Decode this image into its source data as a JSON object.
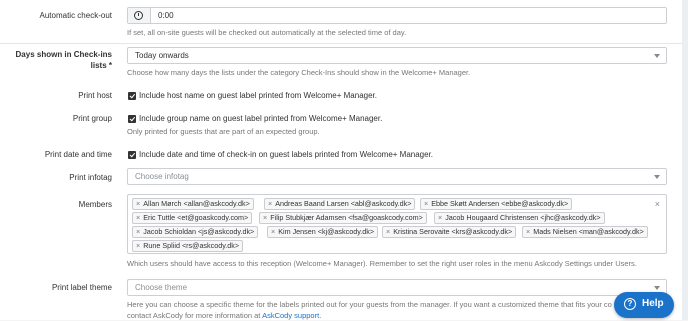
{
  "auto_checkout": {
    "label": "Automatic check-out",
    "value": "0:00",
    "help": "If set, all on-site guests will be checked out automatically at the selected time of day."
  },
  "days_shown": {
    "label_line1": "Days shown in Check-ins",
    "label_line2": "lists *",
    "value": "Today onwards",
    "help": "Choose how many days the lists under the category Check-Ins should show in the Welcome+ Manager."
  },
  "print_host": {
    "label": "Print host",
    "text": "Include host name on guest label printed from Welcome+ Manager."
  },
  "print_group": {
    "label": "Print group",
    "text": "Include group name on guest label printed from Welcome+ Manager.",
    "help": "Only printed for guests that are part of an expected group."
  },
  "print_date": {
    "label": "Print date and time",
    "text": "Include date and time of check-in on guest labels printed from Welcome+ Manager."
  },
  "print_infotag": {
    "label": "Print infotag",
    "placeholder": "Choose infotag"
  },
  "members": {
    "label": "Members",
    "tags": [
      "Allan Mørch <allan@askcody.dk>",
      "Andreas Baand Larsen <abl@askcody.dk>",
      "Ebbe Skøtt Andersen <ebbe@askcody.dk>",
      "Eric Tuttle <et@goaskcody.com>",
      "Filip Stubkjær Adamsen <fsa@goaskcody.com>",
      "Jacob Hougaard Christensen <jhc@askcody.dk>",
      "Jacob Schioldan <js@askcody.dk>",
      "Kim Jensen <kj@askcody.dk>",
      "Kristina Serovaite <krs@askcody.dk>",
      "Mads Nielsen <man@askcody.dk>",
      "Rune Spliid <rs@askcody.dk>"
    ],
    "help": "Which users should have access to this reception (Welcome+ Manager). Remember to set the right user roles in the menu Askcody Settings under Users."
  },
  "label_theme": {
    "label": "Print label theme",
    "placeholder": "Choose theme",
    "help_line1": "Here you can choose a specific theme for the labels printed out for your guests from the manager. If you want a customized theme that fits your co",
    "help_line2_pre": "contact AskCody for more information at ",
    "help_link": "AskCody support",
    "help_line2_post": "."
  },
  "help_button": {
    "label": "Help"
  },
  "colors": {
    "accent": "#1a73c8",
    "border": "#ccd0d4",
    "help_text": "#777777"
  }
}
